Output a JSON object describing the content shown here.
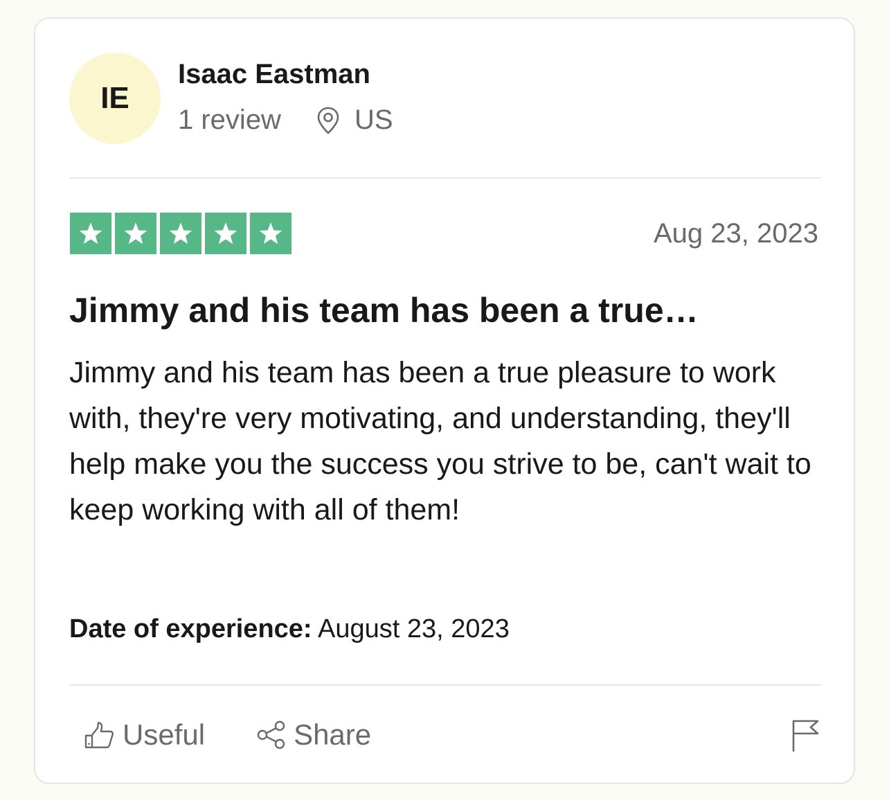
{
  "reviewer": {
    "initials": "IE",
    "name": "Isaac Eastman",
    "review_count": "1 review",
    "country": "US"
  },
  "review": {
    "rating": 5,
    "rating_max": 5,
    "date": "Aug 23, 2023",
    "title": "Jimmy and his team has been a true…",
    "body": "Jimmy and his team has been a true pleasure to work with, they're very motivating, and understanding, they'll help make you the success you strive to be, can't wait to keep working with all of them!",
    "experience_label": "Date of experience:",
    "experience_date": "August 23, 2023"
  },
  "actions": {
    "useful_label": "Useful",
    "share_label": "Share"
  },
  "icons": {
    "star": "star-icon",
    "location": "location-pin-icon",
    "useful": "thumbs-up-icon",
    "share": "share-icon",
    "flag": "flag-icon"
  },
  "colors": {
    "star_bg": "#55b886",
    "avatar_bg": "#fcf6cf",
    "card_border": "#e5e5dd",
    "page_bg": "#fbfbf6",
    "muted_text": "#6a6a6a"
  }
}
